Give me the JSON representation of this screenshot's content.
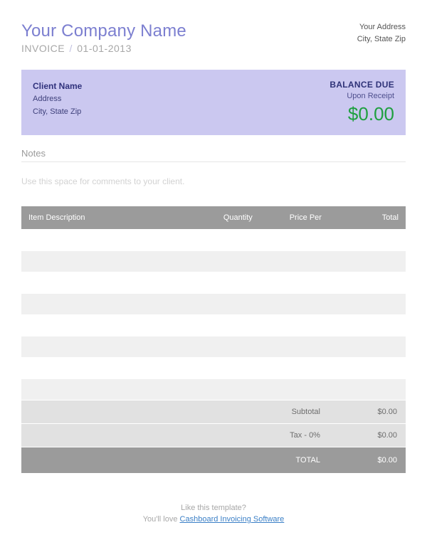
{
  "header": {
    "company_name": "Your Company Name",
    "invoice_label": "INVOICE",
    "invoice_date": "01-01-2013",
    "sender_address": "Your Address",
    "sender_city_state_zip": "City, State Zip"
  },
  "client": {
    "name": "Client Name",
    "address": "Address",
    "city_state_zip": "City, State Zip",
    "balance_due_label": "BALANCE DUE",
    "terms": "Upon Receipt",
    "amount": "$0.00"
  },
  "notes": {
    "heading": "Notes",
    "placeholder": "Use this space for comments to your client."
  },
  "table": {
    "headers": {
      "item": "Item Description",
      "qty": "Quantity",
      "price": "Price Per",
      "total": "Total"
    },
    "row_count": 8,
    "subtotal_label": "Subtotal",
    "subtotal_value": "$0.00",
    "tax_label": "Tax - 0%",
    "tax_value": "$0.00",
    "total_label": "TOTAL",
    "total_value": "$0.00"
  },
  "footer": {
    "line1": "Like this template?",
    "line2_prefix": "You'll love ",
    "link_text": "Cashboard Invoicing Software"
  }
}
